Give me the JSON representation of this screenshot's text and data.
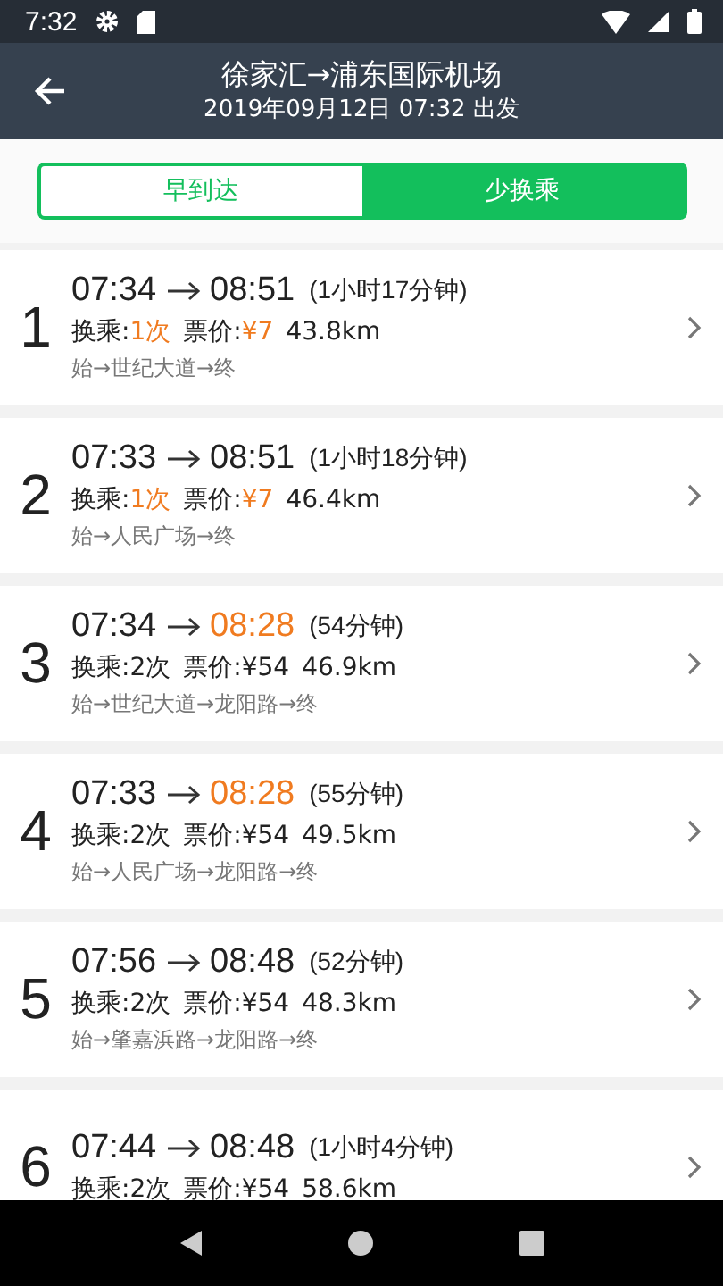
{
  "status_bar": {
    "time": "7:32"
  },
  "header": {
    "title": "徐家汇→浦东国际机场",
    "subtitle": "2019年09月12日 07:32 出发"
  },
  "tabs": [
    {
      "label": "早到达",
      "selected": false
    },
    {
      "label": "少换乘",
      "selected": true
    }
  ],
  "routes": [
    {
      "index": "1",
      "depart": "07:34",
      "arrive": "08:51",
      "arrive_highlight": false,
      "duration": "(1小时17分钟)",
      "transfers_label": "换乘:",
      "transfers": "1次",
      "transfers_highlight": true,
      "price_label": "票价:",
      "price": "¥7",
      "price_highlight": true,
      "distance": "43.8km",
      "path": "始→世纪大道→终"
    },
    {
      "index": "2",
      "depart": "07:33",
      "arrive": "08:51",
      "arrive_highlight": false,
      "duration": "(1小时18分钟)",
      "transfers_label": "换乘:",
      "transfers": "1次",
      "transfers_highlight": true,
      "price_label": "票价:",
      "price": "¥7",
      "price_highlight": true,
      "distance": "46.4km",
      "path": "始→人民广场→终"
    },
    {
      "index": "3",
      "depart": "07:34",
      "arrive": "08:28",
      "arrive_highlight": true,
      "duration": "(54分钟)",
      "transfers_label": "换乘:",
      "transfers": "2次",
      "transfers_highlight": false,
      "price_label": "票价:",
      "price": "¥54",
      "price_highlight": false,
      "distance": "46.9km",
      "path": "始→世纪大道→龙阳路→终"
    },
    {
      "index": "4",
      "depart": "07:33",
      "arrive": "08:28",
      "arrive_highlight": true,
      "duration": "(55分钟)",
      "transfers_label": "换乘:",
      "transfers": "2次",
      "transfers_highlight": false,
      "price_label": "票价:",
      "price": "¥54",
      "price_highlight": false,
      "distance": "49.5km",
      "path": "始→人民广场→龙阳路→终"
    },
    {
      "index": "5",
      "depart": "07:56",
      "arrive": "08:48",
      "arrive_highlight": false,
      "duration": "(52分钟)",
      "transfers_label": "换乘:",
      "transfers": "2次",
      "transfers_highlight": false,
      "price_label": "票价:",
      "price": "¥54",
      "price_highlight": false,
      "distance": "48.3km",
      "path": "始→肇嘉浜路→龙阳路→终"
    },
    {
      "index": "6",
      "depart": "07:44",
      "arrive": "08:48",
      "arrive_highlight": false,
      "duration": "(1小时4分钟)",
      "transfers_label": "换乘:",
      "transfers": "2次",
      "transfers_highlight": false,
      "price_label": "票价:",
      "price": "¥54",
      "price_highlight": false,
      "distance": "58.6km"
    }
  ]
}
